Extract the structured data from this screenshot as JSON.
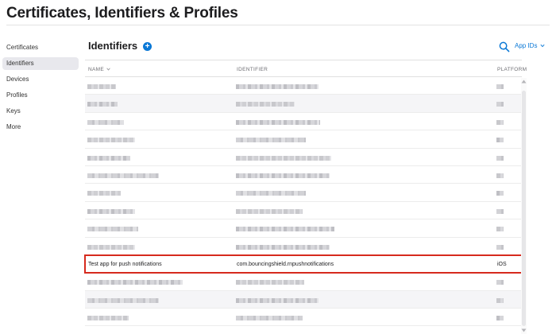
{
  "page": {
    "title": "Certificates, Identifiers & Profiles"
  },
  "sidebar": {
    "items": [
      {
        "label": "Certificates"
      },
      {
        "label": "Identifiers"
      },
      {
        "label": "Devices"
      },
      {
        "label": "Profiles"
      },
      {
        "label": "Keys"
      },
      {
        "label": "More"
      }
    ],
    "active": "Identifiers"
  },
  "main": {
    "heading": "Identifiers",
    "add_symbol": "+",
    "filter_label": "App IDs",
    "columns": {
      "name": "NAME",
      "identifier": "IDENTIFIER",
      "platform": "PLATFORM"
    }
  },
  "selected_row": {
    "name": "Test app for push notifications",
    "identifier": "com.bouncingshield.rnpushnotifications",
    "platform": "iOS"
  },
  "icons": {
    "add": "plus-circle-icon",
    "search": "magnifier-icon",
    "filter_chevron": "chevron-down-icon",
    "sort": "sort-chevron-icon"
  },
  "colors": {
    "accent": "#0a78d6",
    "highlight": "#d62a1e"
  }
}
